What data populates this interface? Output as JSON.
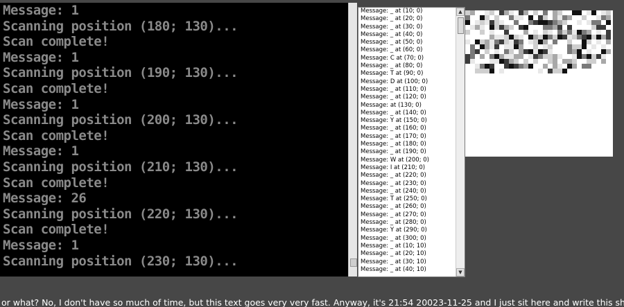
{
  "console": {
    "lines": [
      "Message: 1",
      "Scanning position (180; 130)...",
      "Scan complete!",
      "Message: 1",
      "Scanning position (190; 130)...",
      "Scan complete!",
      "Message: 1",
      "Scanning position (200; 130)...",
      "Scan complete!",
      "Message: 1",
      "Scanning position (210; 130)...",
      "Scan complete!",
      "Message: 26",
      "Scanning position (220; 130)...",
      "Scan complete!",
      "Message: 1",
      "Scanning position (230; 130)..."
    ]
  },
  "message_list": {
    "items": [
      "Message: _ at (10; 0)",
      "Message: _ at (20; 0)",
      "Message: _ at (30; 0)",
      "Message: _ at (40; 0)",
      "Message: _ at (50; 0)",
      "Message: _ at (60; 0)",
      "Message: C at (70; 0)",
      "Message: _ at (80; 0)",
      "Message: T at (90; 0)",
      "Message: D at (100; 0)",
      "Message: _ at (110; 0)",
      "Message: _ at (120; 0)",
      "Message:  at (130; 0)",
      "Message: _ at (140; 0)",
      "Message: Y at (150; 0)",
      "Message: _ at (160; 0)",
      "Message: _ at (170; 0)",
      "Message: _ at (180; 0)",
      "Message: _ at (190; 0)",
      "Message: W at (200; 0)",
      "Message: I at (210; 0)",
      "Message: _ at (220; 0)",
      "Message: _ at (230; 0)",
      "Message: _ at (240; 0)",
      "Message: T at (250; 0)",
      "Message: _ at (260; 0)",
      "Message: _ at (270; 0)",
      "Message: _ at (280; 0)",
      "Message: Y at (290; 0)",
      "Message: _ at (300; 0)",
      "Message: _ at (10; 10)",
      "Message: _ at (20; 10)",
      "Message: _ at (30; 10)",
      "Message: _ at (40; 10)"
    ]
  },
  "ticker": {
    "text": "or what? No, I don't have so much of time, but this text goes very very fast. Anyway, it's 21:54 20023-11-25 and I just sit here and write this shitty document about nothing! I real"
  },
  "colors": {
    "background": "#474747",
    "console_bg": "#000000",
    "console_text": "#8a8a8a",
    "ticker_text": "#ffffff"
  },
  "icons": {
    "scroll_up": "triangle-up",
    "scroll_down": "triangle-down"
  }
}
